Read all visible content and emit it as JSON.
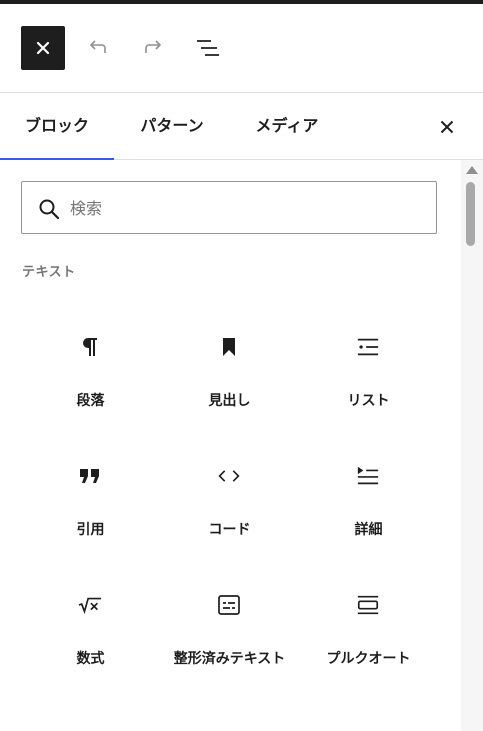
{
  "toolbar": {
    "close_icon": "close-icon",
    "undo_icon": "undo-icon",
    "redo_icon": "redo-icon",
    "outline_icon": "list-view-icon"
  },
  "tabs": [
    {
      "label": "ブロック",
      "active": true
    },
    {
      "label": "パターン",
      "active": false
    },
    {
      "label": "メディア",
      "active": false
    }
  ],
  "search": {
    "placeholder": "検索",
    "value": ""
  },
  "section": {
    "title": "テキスト"
  },
  "blocks": [
    {
      "label": "段落",
      "icon": "paragraph-icon"
    },
    {
      "label": "見出し",
      "icon": "heading-bookmark-icon"
    },
    {
      "label": "リスト",
      "icon": "list-icon"
    },
    {
      "label": "引用",
      "icon": "quote-icon"
    },
    {
      "label": "コード",
      "icon": "code-icon"
    },
    {
      "label": "詳細",
      "icon": "details-icon"
    },
    {
      "label": "数式",
      "icon": "math-icon"
    },
    {
      "label": "整形済みテキスト",
      "icon": "preformatted-icon"
    },
    {
      "label": "プルクオート",
      "icon": "pullquote-icon"
    }
  ],
  "colors": {
    "accent": "#3858e9",
    "dark": "#1e1e1e",
    "muted": "#757575"
  }
}
